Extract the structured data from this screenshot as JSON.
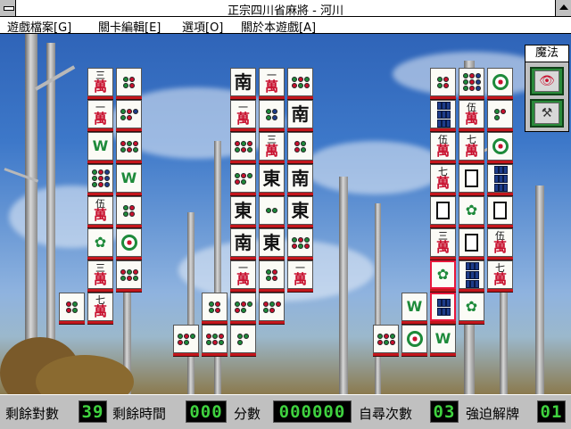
{
  "window": {
    "title": "正宗四川省麻將 - 河川"
  },
  "menu": [
    {
      "label": "遊戲檔案[G]"
    },
    {
      "label": "關卡編輯[E]"
    },
    {
      "label": "選項[O]"
    },
    {
      "label": "關於本遊戲[A]"
    }
  ],
  "magic": {
    "title": "魔法",
    "buttons": [
      {
        "icon": "eye-icon"
      },
      {
        "icon": "hammer-icon"
      }
    ]
  },
  "status": {
    "pairs_label": "剩餘對數",
    "pairs_value": "39",
    "time_label": "剩餘時間",
    "time_value": "000",
    "score_label": "分數",
    "score_value": "000000",
    "hint_label": "自尋次數",
    "hint_value": "03",
    "shuffle_label": "強迫解牌",
    "shuffle_value": "01"
  },
  "tiles": [
    {
      "col": 0,
      "row": 0,
      "kind": "wan",
      "text": "三"
    },
    {
      "col": 1,
      "row": 0,
      "kind": "dots",
      "n": 4
    },
    {
      "col": 0,
      "row": 1,
      "kind": "wan",
      "text": "一"
    },
    {
      "col": 1,
      "row": 1,
      "kind": "dots",
      "n": 5
    },
    {
      "col": 0,
      "row": 2,
      "kind": "bamboo-w",
      "text": "W"
    },
    {
      "col": 1,
      "row": 2,
      "kind": "dots",
      "n": 6
    },
    {
      "col": 0,
      "row": 3,
      "kind": "dots",
      "n": 9
    },
    {
      "col": 1,
      "row": 3,
      "kind": "bamboo-w",
      "text": "W"
    },
    {
      "col": 0,
      "row": 4,
      "kind": "wan",
      "text": "伍"
    },
    {
      "col": 1,
      "row": 4,
      "kind": "dots",
      "n": 4
    },
    {
      "col": 0,
      "row": 5,
      "kind": "bird"
    },
    {
      "col": 1,
      "row": 5,
      "kind": "circle"
    },
    {
      "col": 0,
      "row": 6,
      "kind": "wan",
      "text": "三"
    },
    {
      "col": 1,
      "row": 6,
      "kind": "dots",
      "n": 6
    },
    {
      "col": 0,
      "row": 7,
      "kind": "wan",
      "text": "七"
    }
  ]
}
